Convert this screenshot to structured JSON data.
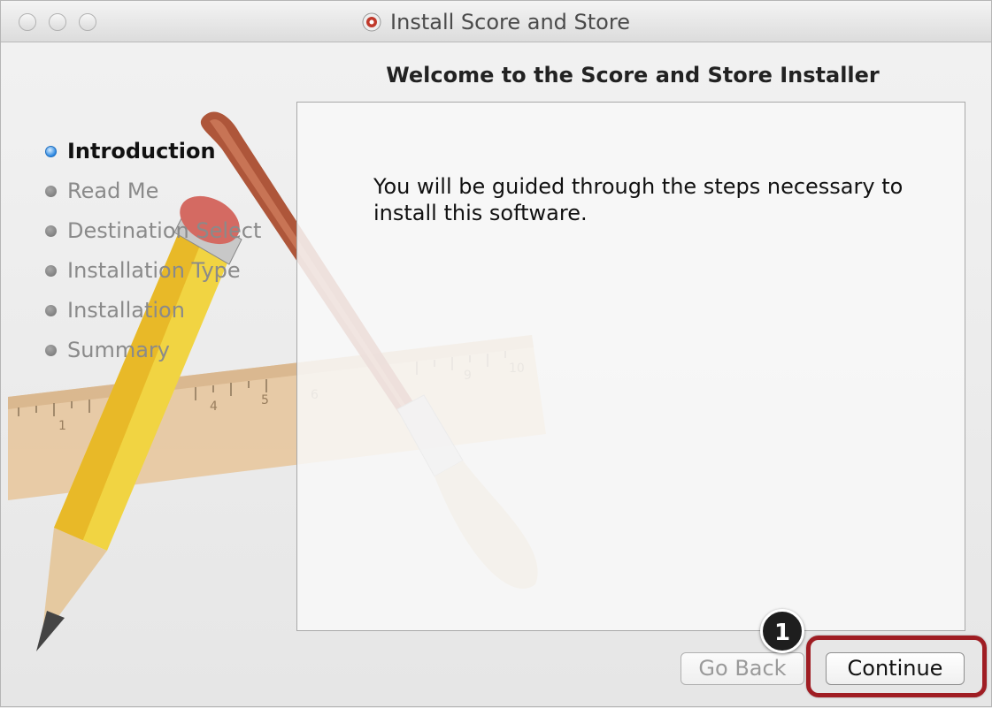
{
  "window": {
    "title": "Install Score and Store"
  },
  "installer": {
    "heading": "Welcome to the Score and Store Installer",
    "steps": [
      {
        "label": "Introduction",
        "active": true
      },
      {
        "label": "Read Me",
        "active": false
      },
      {
        "label": "Destination Select",
        "active": false
      },
      {
        "label": "Installation Type",
        "active": false
      },
      {
        "label": "Installation",
        "active": false
      },
      {
        "label": "Summary",
        "active": false
      }
    ],
    "body_text": "You will be guided through the steps necessary to install this software."
  },
  "buttons": {
    "go_back": "Go Back",
    "continue": "Continue"
  },
  "callout": {
    "number": "1"
  },
  "colors": {
    "highlight": "#9f1d23",
    "active_step_dot": "#2a86e0"
  },
  "icons": [
    "app-icon",
    "pencil-illustration",
    "paintbrush-illustration",
    "ruler-illustration"
  ]
}
